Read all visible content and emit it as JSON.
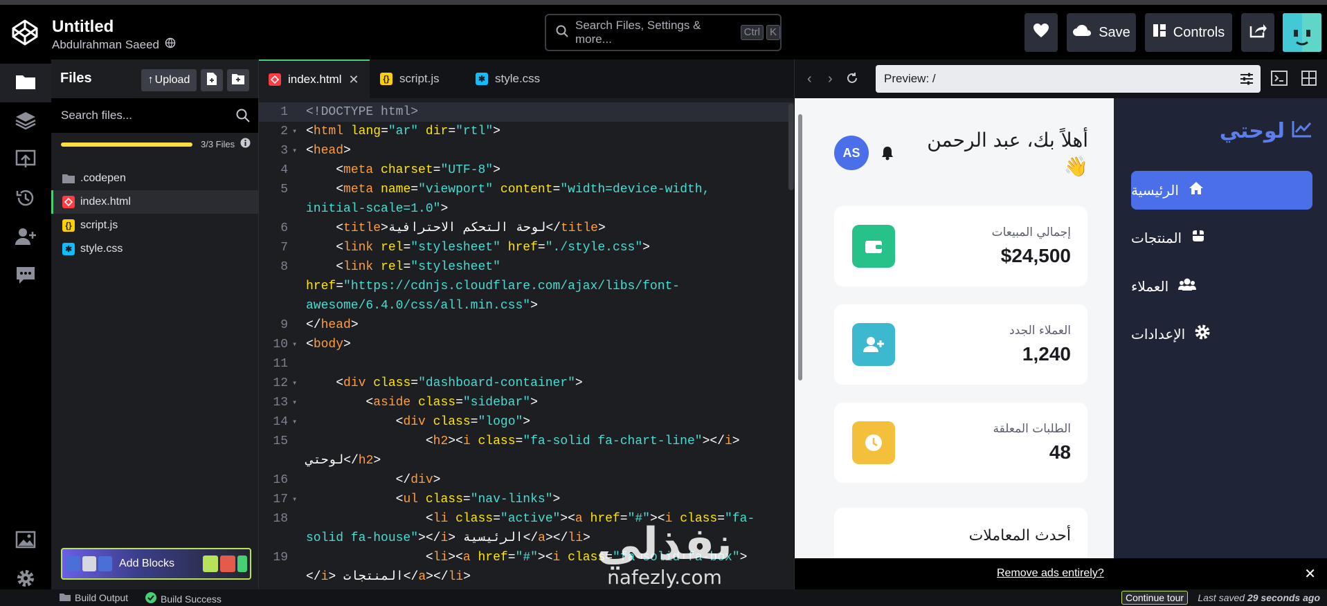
{
  "header": {
    "title": "Untitled",
    "author": "Abdulrahman Saeed",
    "search_placeholder": "Search Files, Settings & more...",
    "kbd_ctrl": "Ctrl",
    "kbd_k": "K",
    "save_label": "Save",
    "controls_label": "Controls"
  },
  "files": {
    "heading": "Files",
    "upload_label": "Upload",
    "search_placeholder": "Search files...",
    "count": "3/3 Files",
    "storage_fraction": 1.0,
    "items": [
      {
        "name": ".codepen",
        "icon": "folder-icon"
      },
      {
        "name": "index.html",
        "icon": "html-file-icon"
      },
      {
        "name": "script.js",
        "icon": "js-file-icon"
      },
      {
        "name": "style.css",
        "icon": "css-file-icon"
      }
    ],
    "add_blocks_label": "Add Blocks"
  },
  "tabs": [
    {
      "label": "index.html"
    },
    {
      "label": "script.js"
    },
    {
      "label": "style.css"
    }
  ],
  "preview": {
    "url": "Preview: /",
    "brand": "لوحتي",
    "nav": [
      {
        "label": "الرئيسية",
        "icon": "house-icon"
      },
      {
        "label": "المنتجات",
        "icon": "box-icon"
      },
      {
        "label": "العملاء",
        "icon": "users-icon"
      },
      {
        "label": "الإعدادات",
        "icon": "gear-icon"
      }
    ],
    "greeting": "أهلاً بك، عبد الرحمن",
    "wave": "👋",
    "avatar_initials": "AS",
    "cards": [
      {
        "label": "إجمالي المبيعات",
        "value": "$24,500",
        "color": "#27c28a"
      },
      {
        "label": "العملاء الجدد",
        "value": "1,240",
        "color": "#3cb9cf"
      },
      {
        "label": "الطلبات المعلقة",
        "value": "48",
        "color": "#f4c03c"
      }
    ],
    "transactions_title": "أحدث المعاملات"
  },
  "ads": {
    "remove_label": "Remove ads entirely?"
  },
  "status": {
    "build_output": "Build Output",
    "build_success": "Build Success",
    "continue_tour": "Continue tour",
    "last_saved_prefix": "Last saved",
    "last_saved_time": "29 seconds ago"
  },
  "watermark": {
    "arabic": "نفذلي",
    "latin": "nafezly.com"
  },
  "code": [
    {
      "n": "1",
      "html": "<span class=\"c\">&lt;!DOCTYPE html&gt;</span>"
    },
    {
      "n": "2",
      "html": "&lt;<span class=\"t\">html</span> <span class=\"a\">lang</span>=<span class=\"s\">\"ar\"</span> <span class=\"a\">dir</span>=<span class=\"s\">\"rtl\"</span>&gt;"
    },
    {
      "n": "3",
      "html": "&lt;<span class=\"t\">head</span>&gt;"
    }
  ]
}
